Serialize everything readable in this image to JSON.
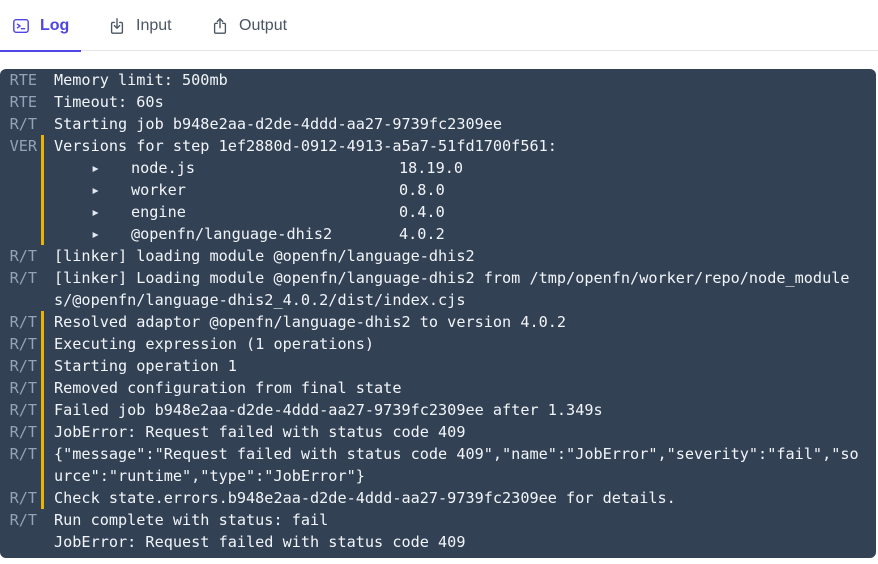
{
  "tabs": [
    {
      "label": "Log",
      "icon": "terminal-icon",
      "active": true
    },
    {
      "label": "Input",
      "icon": "download-icon",
      "active": false
    },
    {
      "label": "Output",
      "icon": "upload-icon",
      "active": false
    }
  ],
  "colors": {
    "accent": "#4f46e5",
    "panel": "#334155",
    "warn_bar": "#eab308"
  },
  "log": {
    "lines": [
      {
        "source": "RTE",
        "text": "Memory limit: 500mb",
        "warn": false
      },
      {
        "source": "RTE",
        "text": "Timeout: 60s",
        "warn": false
      },
      {
        "source": "R/T",
        "text": "Starting job b948e2aa-d2de-4ddd-aa27-9739fc2309ee",
        "warn": false
      },
      {
        "source": "VER",
        "text": "Versions for step 1ef2880d-0912-4913-a5a7-51fd1700f561:",
        "warn": true
      },
      {
        "source": "",
        "bullet": "▸",
        "name": "node.js",
        "version": "18.19.0",
        "warn": true
      },
      {
        "source": "",
        "bullet": "▸",
        "name": "worker",
        "version": "0.8.0",
        "warn": true
      },
      {
        "source": "",
        "bullet": "▸",
        "name": "engine",
        "version": "0.4.0",
        "warn": true
      },
      {
        "source": "",
        "bullet": "▸",
        "name": "@openfn/language-dhis2",
        "version": "4.0.2",
        "warn": true
      },
      {
        "source": "R/T",
        "text": "[linker] loading module @openfn/language-dhis2",
        "warn": false
      },
      {
        "source": "R/T",
        "text": "[linker] Loading module @openfn/language-dhis2 from /tmp/openfn/worker/repo/node_modules/@openfn/language-dhis2_4.0.2/dist/index.cjs",
        "warn": false
      },
      {
        "source": "R/T",
        "text": "Resolved adaptor @openfn/language-dhis2 to version 4.0.2",
        "warn": true
      },
      {
        "source": "R/T",
        "text": "Executing expression (1 operations)",
        "warn": true
      },
      {
        "source": "R/T",
        "text": "Starting operation 1",
        "warn": true
      },
      {
        "source": "R/T",
        "text": "Removed configuration from final state",
        "warn": true
      },
      {
        "source": "R/T",
        "text": "Failed job b948e2aa-d2de-4ddd-aa27-9739fc2309ee after 1.349s",
        "warn": true
      },
      {
        "source": "R/T",
        "text": "JobError: Request failed with status code 409",
        "warn": true
      },
      {
        "source": "R/T",
        "text": "{\"message\":\"Request failed with status code 409\",\"name\":\"JobError\",\"severity\":\"fail\",\"source\":\"runtime\",\"type\":\"JobError\"}",
        "warn": true
      },
      {
        "source": "R/T",
        "text": "Check state.errors.b948e2aa-d2de-4ddd-aa27-9739fc2309ee for details.",
        "warn": true
      },
      {
        "source": "R/T",
        "text": "Run complete with status: fail",
        "warn": false
      },
      {
        "source": "",
        "text": "JobError: Request failed with status code 409",
        "warn": false
      }
    ]
  }
}
